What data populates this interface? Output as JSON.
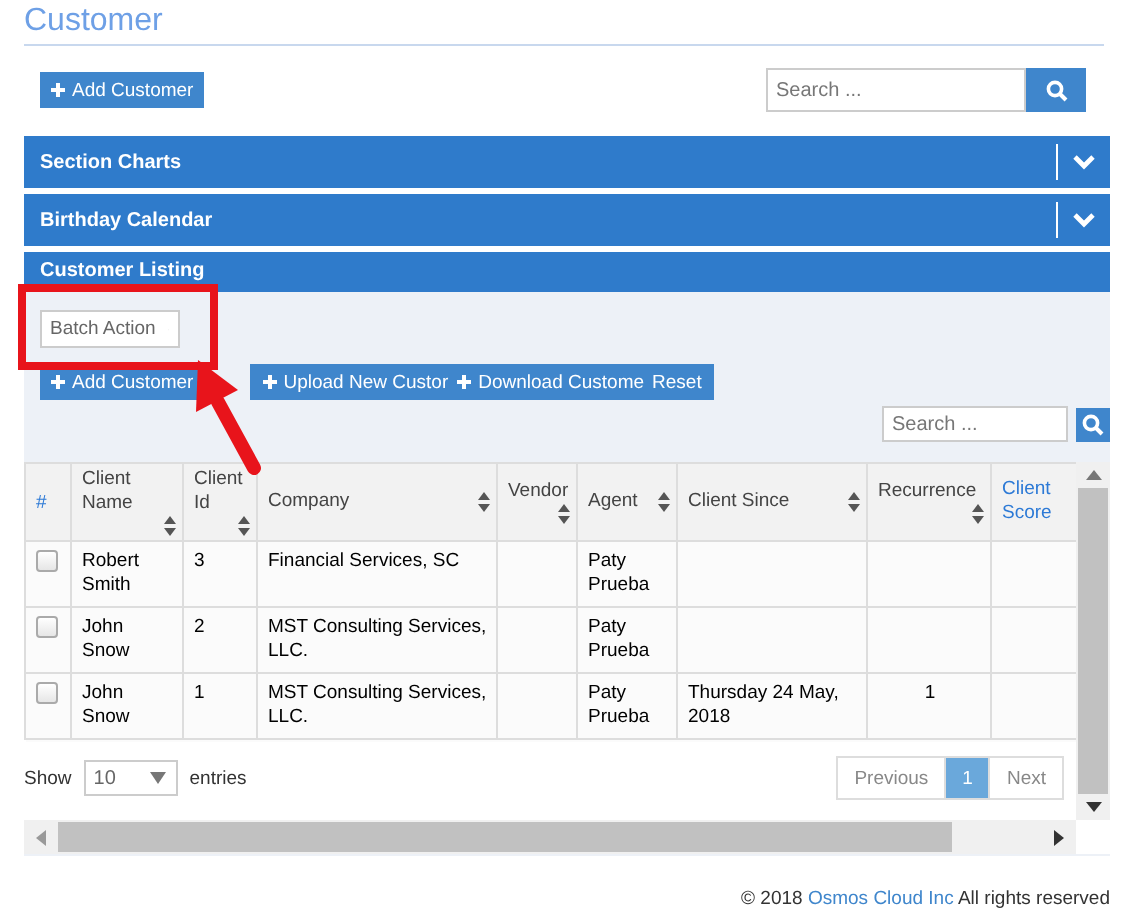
{
  "page_title": "Customer",
  "toolbar": {
    "add_button": "Add Customer",
    "search": {
      "placeholder": "Search ..."
    }
  },
  "panels": [
    {
      "title": "Section Charts",
      "expanded": false
    },
    {
      "title": "Birthday Calendar",
      "expanded": false
    }
  ],
  "listing": {
    "title": "Customer Listing",
    "batch_select": {
      "value": "Batch Action"
    },
    "add_button": "Add Customer",
    "tool_buttons": [
      {
        "label": "Upload New Custor",
        "icon": true
      },
      {
        "label": "Download Custome",
        "icon": true
      },
      {
        "label": "Reset",
        "icon": false
      }
    ],
    "search": {
      "placeholder": "Search ..."
    },
    "table": {
      "select_header": "#",
      "columns": [
        {
          "label": "Client Name",
          "sortable": true
        },
        {
          "label": "Client Id",
          "sortable": true
        },
        {
          "label": "Company",
          "sortable": true
        },
        {
          "label": "Vendor",
          "sortable": true
        },
        {
          "label": "Agent",
          "sortable": true
        },
        {
          "label": "Client Since",
          "sortable": true
        },
        {
          "label": "Recurrence",
          "sortable": true
        },
        {
          "label": "Client Score",
          "sortable": false
        }
      ],
      "rows": [
        {
          "checked": false,
          "cells": [
            "Robert Smith",
            "3",
            "Financial Services, SC",
            "",
            "Paty Prueba",
            "",
            "",
            ""
          ]
        },
        {
          "checked": false,
          "cells": [
            "John Snow",
            "2",
            "MST Consulting Services, LLC.",
            "",
            "Paty Prueba",
            "",
            "",
            ""
          ]
        },
        {
          "checked": false,
          "cells": [
            "John Snow",
            "1",
            "MST Consulting Services, LLC.",
            "",
            "Paty Prueba",
            "Thursday 24 May, 2018",
            "1",
            ""
          ]
        }
      ]
    },
    "show_label": "Show",
    "page_length": "10",
    "entries_label": "entries",
    "pagination": [
      {
        "label": "Previous",
        "selected": false
      },
      {
        "label": "1",
        "selected": true
      },
      {
        "label": "Next",
        "selected": false
      }
    ]
  },
  "footer": {
    "before": "© 2018",
    "link": "Osmos Cloud Inc",
    "after": "All rights reserved"
  }
}
